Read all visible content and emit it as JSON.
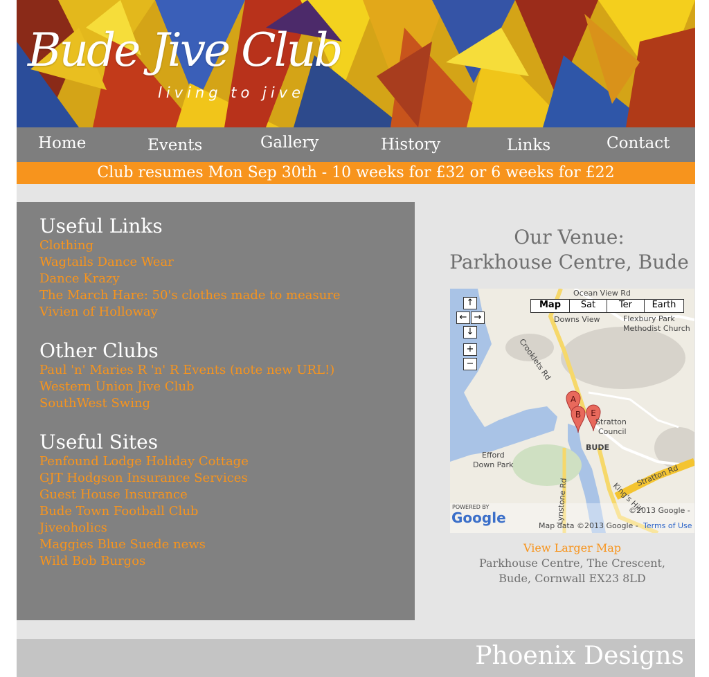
{
  "header": {
    "title": "Bude Jive Club",
    "tagline": "living to jive"
  },
  "nav": {
    "items": [
      "Home",
      "Events",
      "Gallery",
      "History",
      "Links",
      "Contact"
    ]
  },
  "announcement": "Club resumes Mon Sep 30th - 10 weeks for £32 or 6 weeks for £22",
  "useful_links": {
    "title": "Useful Links",
    "items": [
      "Clothing",
      "Wagtails Dance Wear",
      "Dance Krazy",
      "The March Hare: 50's clothes made to measure",
      "Vivien of Holloway"
    ]
  },
  "other_clubs": {
    "title": "Other Clubs",
    "items": [
      "Paul 'n' Maries R 'n' R Events (note new URL!)",
      "Western Union Jive Club",
      "SouthWest Swing"
    ]
  },
  "useful_sites": {
    "title": "Useful Sites",
    "items": [
      "Penfound Lodge Holiday Cottage",
      "GJT Hodgson Insurance Services",
      "Guest House Insurance",
      "Bude Town Football Club",
      "Jiveoholics",
      "Maggies Blue Suede news",
      "Wild Bob Burgos"
    ]
  },
  "venue": {
    "heading_line1": "Our Venue:",
    "heading_line2": "Parkhouse Centre, Bude",
    "view_larger": "View Larger Map",
    "address_line1": "Parkhouse Centre, The Crescent,",
    "address_line2": "Bude, Cornwall EX23 8LD"
  },
  "map": {
    "tabs": [
      "Map",
      "Sat",
      "Ter",
      "Earth"
    ],
    "active_tab": "Map",
    "labels": {
      "ocean_view": "Ocean View Rd",
      "downs_view": "Downs View",
      "flexbury": "Flexbury Park",
      "methodist": "Methodist Church",
      "crooklets": "Crooklets Rd",
      "stratton": "Stratton",
      "council": "Council",
      "bude": "BUDE",
      "efford1": "Efford",
      "efford2": "Down Park",
      "stratton_rd": "Stratton Rd",
      "lynstone": "Lynstone Rd",
      "kings_hill": "King's Hill",
      "powered_by": "POWERED BY",
      "google": "Google",
      "copyright": "©2013 Google -",
      "map_data": "Map data ©2013 Google -",
      "terms": "Terms of Use"
    },
    "markers": [
      "A",
      "B",
      "E"
    ]
  },
  "footer": {
    "credit": "Phoenix Designs"
  },
  "colors": {
    "orange": "#f7941d",
    "nav_grey": "#7e7e7e",
    "panel_grey": "#818181",
    "page_bg": "#e5e5e5"
  }
}
